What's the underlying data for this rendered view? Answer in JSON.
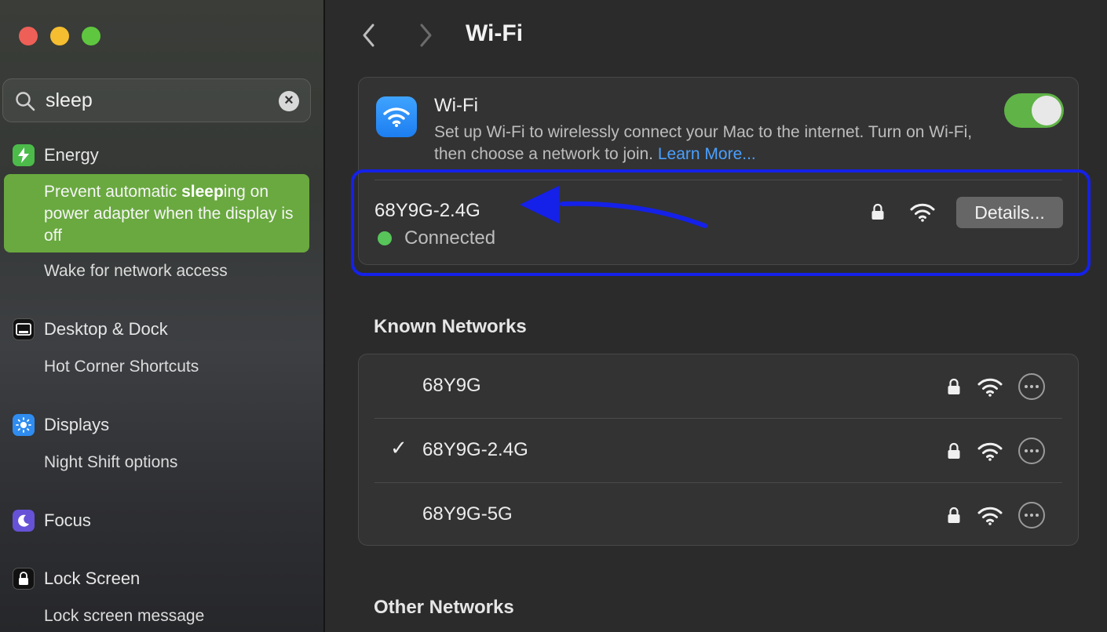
{
  "sidebar": {
    "search": {
      "query": "sleep"
    },
    "energy": {
      "label": "Energy",
      "highlight_prefix": "Prevent automatic ",
      "highlight_match": "sleep",
      "highlight_suffix": "ing on power adapter when the display is off",
      "sub2": "Wake for network access"
    },
    "desktop": {
      "label": "Desktop & Dock",
      "sub": "Hot Corner Shortcuts"
    },
    "displays": {
      "label": "Displays",
      "sub": "Night Shift options"
    },
    "focus": {
      "label": "Focus"
    },
    "lockscreen": {
      "label": "Lock Screen",
      "sub": "Lock screen message"
    }
  },
  "header": {
    "title": "Wi-Fi"
  },
  "wifi_card": {
    "title": "Wi-Fi",
    "description": "Set up Wi-Fi to wirelessly connect your Mac to the internet. Turn on Wi-Fi, then choose a network to join.",
    "learn_more": "Learn More...",
    "toggle_on": true,
    "current_network": "68Y9G-2.4G",
    "status": "Connected",
    "details_label": "Details..."
  },
  "known_networks": {
    "title": "Known Networks",
    "items": [
      {
        "name": "68Y9G",
        "check": ""
      },
      {
        "name": "68Y9G-2.4G",
        "check": "✓"
      },
      {
        "name": "68Y9G-5G",
        "check": ""
      }
    ]
  },
  "other_networks": {
    "title": "Other Networks"
  },
  "colors": {
    "accent_blue": "#1521e8",
    "highlight_green": "#69a93f",
    "toggle_green": "#5fb347",
    "connected_dot": "#57c55a",
    "link": "#4aa0ff"
  }
}
